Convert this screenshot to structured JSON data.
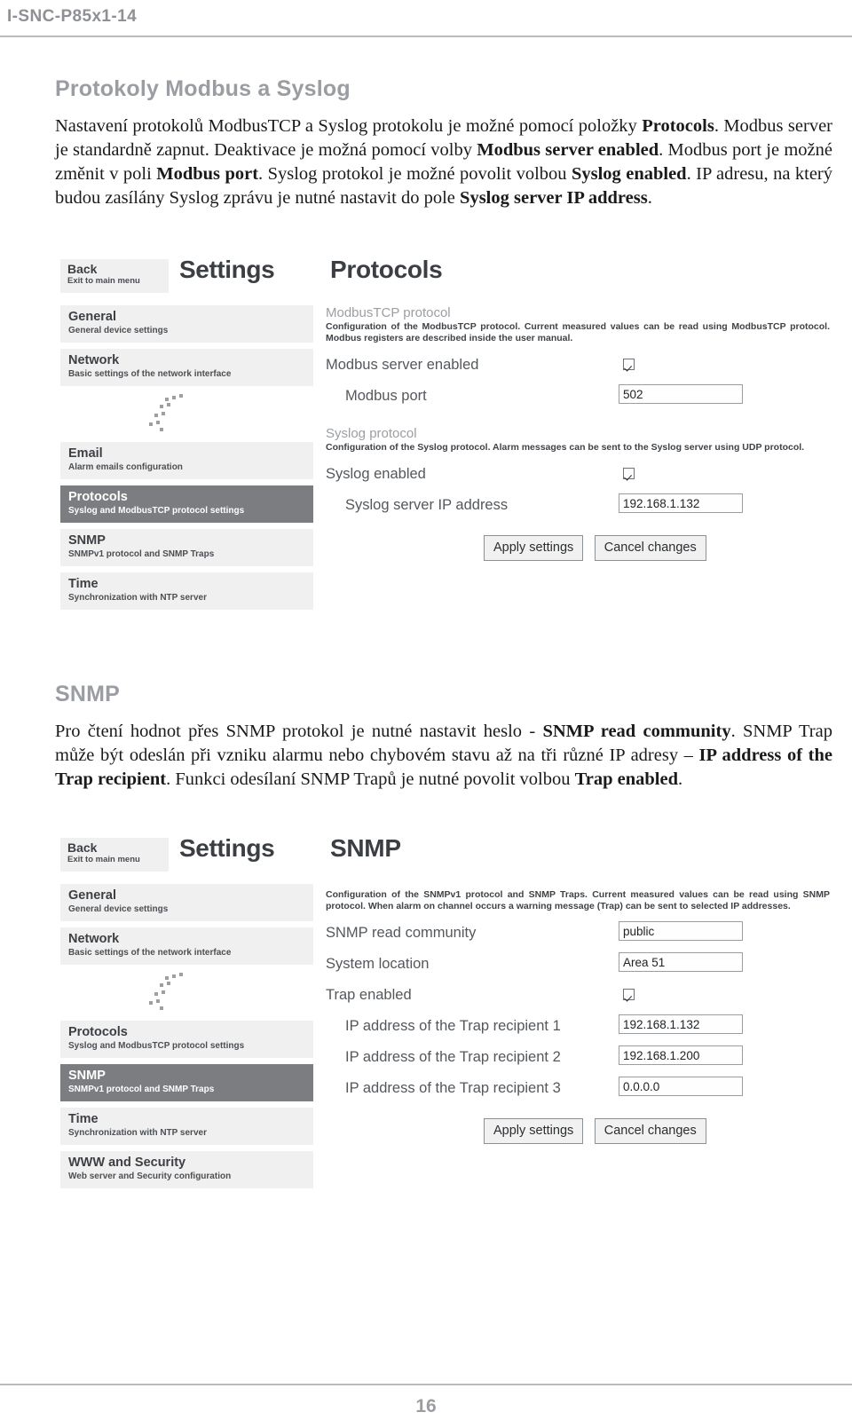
{
  "document": {
    "running_header": "I-SNC-P85x1-14",
    "page_number": "16"
  },
  "sections": [
    {
      "title": "Protokoly Modbus a Syslog",
      "paragraph_html": "Nastavení protokolů ModbusTCP a Syslog protokolu je možné pomocí položky <b>Protocols</b>. Modbus server je standardně zapnut. Deaktivace je možná pomocí volby <b>Modbus server enabled</b>. Modbus port je možné změnit v poli <b>Modbus port</b>. Syslog protokol je možné povolit volbou <b>Syslog enabled</b>. IP adresu, na který budou zasílány Syslog zprávu je nutné nastavit do pole <b>Syslog server IP address</b>."
    },
    {
      "title": "SNMP",
      "paragraph_html": "Pro čtení hodnot přes SNMP protokol je nutné nastavit heslo - <b>SNMP read community</b>. SNMP Trap může být odeslán při vzniku alarmu nebo chybovém stavu až na tři různé IP adresy – <b>IP address of the Trap recipient</b>. Funkci odesílaní SNMP Trapů je nutné povolit volbou <b>Trap enabled</b>."
    }
  ],
  "screenshot_protocols": {
    "back_button": {
      "title": "Back",
      "subtitle": "Exit to main menu"
    },
    "app_title": "Settings",
    "page_title": "Protocols",
    "sidebar": [
      {
        "title": "General",
        "subtitle": "General device settings",
        "active": false
      },
      {
        "title": "Network",
        "subtitle": "Basic settings of the network interface",
        "active": false
      },
      {
        "title": "Email",
        "subtitle": "Alarm emails configuration",
        "active": false
      },
      {
        "title": "Protocols",
        "subtitle": "Syslog and ModbusTCP protocol settings",
        "active": true
      },
      {
        "title": "SNMP",
        "subtitle": "SNMPv1 protocol and SNMP Traps",
        "active": false
      },
      {
        "title": "Time",
        "subtitle": "Synchronization with NTP server",
        "active": false
      }
    ],
    "groups": [
      {
        "title": "ModbusTCP protocol",
        "description": "Configuration of the ModbusTCP protocol. Current measured values can be read using ModbusTCP protocol. Modbus registers are described inside the user manual.",
        "fields": [
          {
            "label": "Modbus server enabled",
            "type": "checkbox",
            "checked": true
          },
          {
            "label": "Modbus port",
            "type": "text",
            "value": "502",
            "indent": true
          }
        ]
      },
      {
        "title": "Syslog protocol",
        "description": "Configuration of the Syslog protocol. Alarm messages can be sent to the Syslog server using UDP protocol.",
        "fields": [
          {
            "label": "Syslog enabled",
            "type": "checkbox",
            "checked": true
          },
          {
            "label": "Syslog server IP address",
            "type": "text",
            "value": "192.168.1.132",
            "indent": true
          }
        ]
      }
    ],
    "apply_button": "Apply settings",
    "cancel_button": "Cancel changes"
  },
  "screenshot_snmp": {
    "back_button": {
      "title": "Back",
      "subtitle": "Exit to main menu"
    },
    "app_title": "Settings",
    "page_title": "SNMP",
    "sidebar": [
      {
        "title": "General",
        "subtitle": "General device settings",
        "active": false
      },
      {
        "title": "Network",
        "subtitle": "Basic settings of the network interface",
        "active": false
      },
      {
        "title": "Protocols",
        "subtitle": "Syslog and ModbusTCP protocol settings",
        "active": false
      },
      {
        "title": "SNMP",
        "subtitle": "SNMPv1 protocol and SNMP Traps",
        "active": true
      },
      {
        "title": "Time",
        "subtitle": "Synchronization with NTP server",
        "active": false
      },
      {
        "title": "WWW and Security",
        "subtitle": "Web server and Security configuration",
        "active": false
      }
    ],
    "groups": [
      {
        "title": "",
        "description": "Configuration of the SNMPv1 protocol and SNMP Traps. Current measured values can be read using SNMP protocol. When alarm on channel occurs a warning message (Trap) can be sent to selected IP addresses.",
        "fields": [
          {
            "label": "SNMP read community",
            "type": "text",
            "value": "public"
          },
          {
            "label": "System location",
            "type": "text",
            "value": "Area 51"
          },
          {
            "label": "Trap enabled",
            "type": "checkbox",
            "checked": true
          },
          {
            "label": "IP address of the Trap recipient 1",
            "type": "text",
            "value": "192.168.1.132",
            "indent": true
          },
          {
            "label": "IP address of the Trap recipient 2",
            "type": "text",
            "value": "192.168.1.200",
            "indent": true
          },
          {
            "label": "IP address of the Trap recipient 3",
            "type": "text",
            "value": "0.0.0.0",
            "indent": true
          }
        ]
      }
    ],
    "apply_button": "Apply settings",
    "cancel_button": "Cancel changes"
  },
  "colors": {
    "header_gray": "#9a9da1",
    "active_item": "#7b7d80",
    "item_bg": "#f0f0f0"
  }
}
